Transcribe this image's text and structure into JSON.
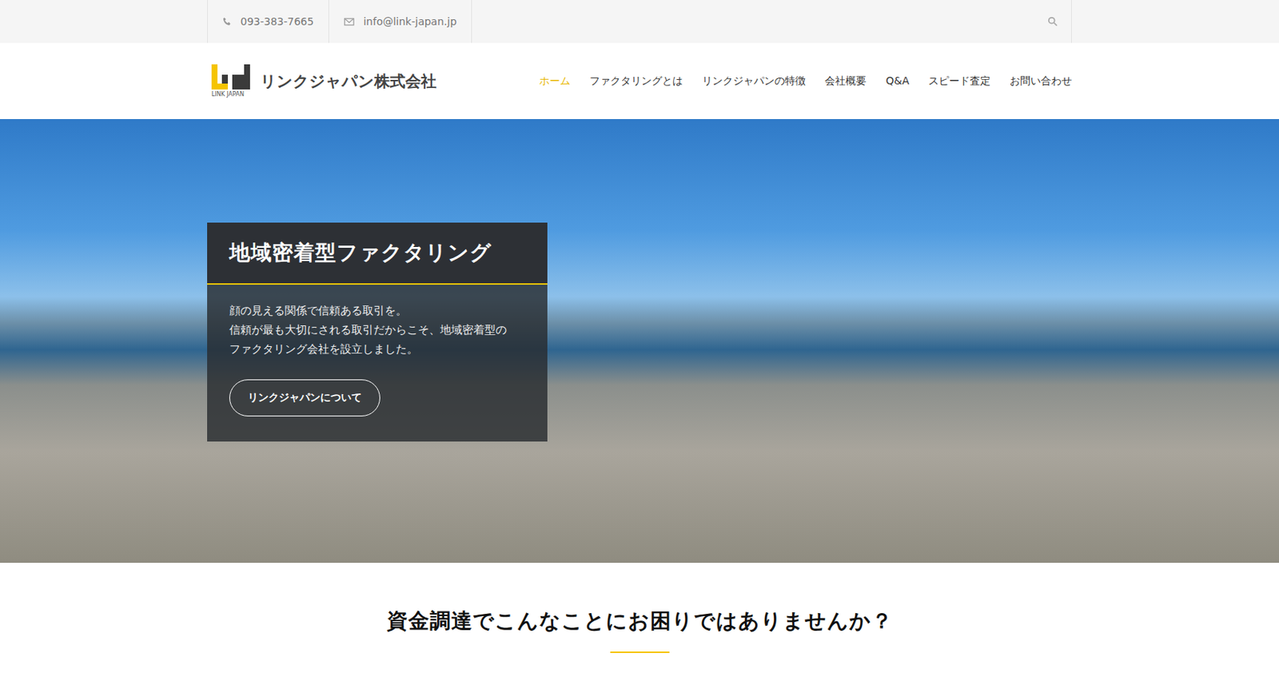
{
  "topbar": {
    "phone": "093-383-7665",
    "email": "info@link-japan.jp"
  },
  "logo": {
    "mark_text": "LINK JAPAN",
    "name": "リンクジャパン株式会社"
  },
  "nav": [
    {
      "label": "ホーム",
      "selected": true
    },
    {
      "label": "ファクタリングとは",
      "selected": false
    },
    {
      "label": "リンクジャパンの特徴",
      "selected": false
    },
    {
      "label": "会社概要",
      "selected": false
    },
    {
      "label": "Q&A",
      "selected": false
    },
    {
      "label": "スピード査定",
      "selected": false
    },
    {
      "label": "お問い合わせ",
      "selected": false
    }
  ],
  "hero": {
    "title": "地域密着型ファクタリング",
    "lines": [
      "顔の見える関係で信頼ある取引を。",
      "信頼が最も大切にされる取引だからこそ、地域密着型の",
      "ファクタリング会社を設立しました。"
    ],
    "button": "リンクジャパンについて"
  },
  "section": {
    "heading": "資金調達でこんなことにお困りではありませんか？"
  }
}
